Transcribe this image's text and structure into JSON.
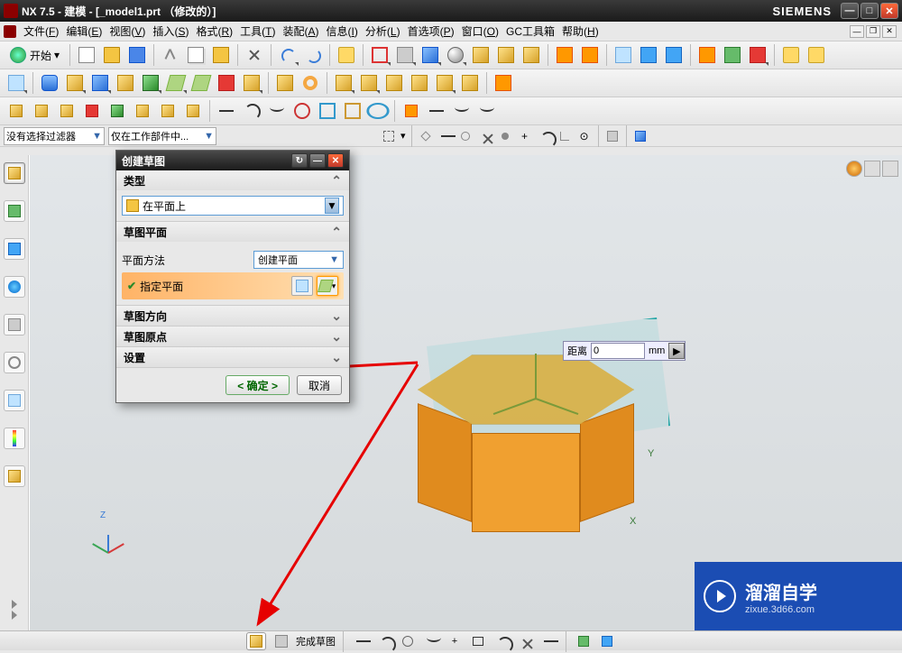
{
  "title_bar": {
    "text": "NX 7.5 - 建模 - [_model1.prt （修改的）]",
    "brand": "SIEMENS"
  },
  "menu": {
    "items": [
      {
        "label": "文件",
        "key": "F"
      },
      {
        "label": "编辑",
        "key": "E"
      },
      {
        "label": "视图",
        "key": "V"
      },
      {
        "label": "插入",
        "key": "S"
      },
      {
        "label": "格式",
        "key": "R"
      },
      {
        "label": "工具",
        "key": "T"
      },
      {
        "label": "装配",
        "key": "A"
      },
      {
        "label": "信息",
        "key": "I"
      },
      {
        "label": "分析",
        "key": "L"
      },
      {
        "label": "首选项",
        "key": "P"
      },
      {
        "label": "窗口",
        "key": "O"
      },
      {
        "label": "GC工具箱",
        "key": ""
      },
      {
        "label": "帮助",
        "key": "H"
      }
    ]
  },
  "start_button": {
    "label": "开始"
  },
  "filter": {
    "label": "没有选择过滤器",
    "scope": "仅在工作部件中..."
  },
  "dialog": {
    "title": "创建草图",
    "sections": {
      "type": {
        "header": "类型",
        "dropdown_icon_desc": "在平面上"
      },
      "plane": {
        "header": "草图平面",
        "method_label": "平面方法",
        "method_value": "创建平面",
        "specify_label": "指定平面"
      },
      "direction": {
        "header": "草图方向"
      },
      "origin": {
        "header": "草图原点"
      },
      "settings": {
        "header": "设置"
      }
    },
    "buttons": {
      "ok": "< 确定 >",
      "cancel": "取消"
    }
  },
  "floater": {
    "label": "距离",
    "value": "0",
    "unit": "mm"
  },
  "status_bar": {
    "finish_sketch": "完成草图"
  },
  "watermark": {
    "big_text": "溜溜自学",
    "small_text": "zixue.3d66.com"
  },
  "viewport_axes": {
    "x": "X",
    "y": "Y",
    "z": "Z"
  }
}
